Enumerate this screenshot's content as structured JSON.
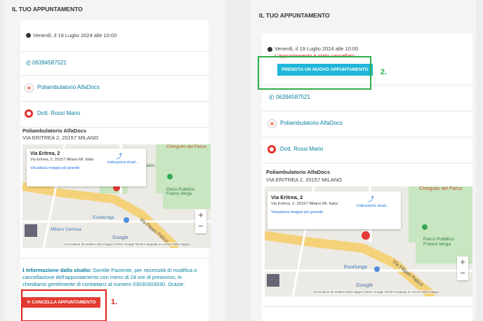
{
  "colors": {
    "annotation_red": "#e0231b",
    "annotation_green": "#2fad4a",
    "link": "#0a7fa0",
    "cancel": "#e23c32",
    "rebook": "#1fb6d8"
  },
  "left": {
    "title": "IL TUO APPUNTAMENTO",
    "date": "Venerdì, il 19 Luglio 2024 alle 10:00",
    "phone": "06394587521",
    "clinic": "Poliambulatorio AlfaDocs",
    "doctor": "Dott. Rossi Mario",
    "address_name": "Poliambulatorio AlfaDocs",
    "address_line": "VIA ERITREA 2, 20157 MILANO",
    "map": {
      "place": "Via Eritrea, 2",
      "place_addr": "Via Eritrea, 2, 20157 Milano MI, Italia",
      "directions": "Indicazioni strad...",
      "view_larger": "Visualizza mappa più grande",
      "footer": "Scorciatoie da tastiera   Dati mappa ©2024 Google   Termini   Segnala un errore nella mappa",
      "labels": [
        "Chinguito del Parco",
        "Calcio",
        "Parco Pubblico Franco Verga",
        "Via Filippo Palizzi",
        "Esselunga",
        "Milano Certosa",
        "Google"
      ]
    },
    "info_label": "Informazione dallo studio:",
    "info_text": "Gentile Paziente, per necessità di modifica o cancellazione dell'appuntamento con meno di 24 ore di preavviso, le chiediamo gentilmente di contattarci al numero 03030303030. Grazie.",
    "cancel_button": "CANCELLA APPUNTAMENTO",
    "annotation": "1."
  },
  "right": {
    "title": "IL TUO APPUNTAMENTO",
    "date": "Venerdì, il 19 Luglio 2024 alle 10:00",
    "cancelled": "L'appuntamento è stato cancellato",
    "rebook_button": "PRENOTA UN NUOVO APPUNTAMENTO",
    "annotation": "2.",
    "phone": "06394587521",
    "clinic": "Poliambulatorio AlfaDocs",
    "doctor": "Dott. Rossi Mario",
    "address_name": "Poliambulatorio AlfaDocs",
    "address_line": "VIA ERITREA 2, 20157 MILANO",
    "map": {
      "place": "Via Eritrea, 2",
      "place_addr": "Via Eritrea, 2, 20157 Milano MI, Italia",
      "directions": "Indicazioni strad...",
      "view_larger": "Visualizza mappa più grande",
      "footer": "Scorciatoie da tastiera   Dati mappa ©2024 Google   Termini   Segnala un errore nella mappa",
      "labels": [
        "Chinguito del Parco",
        "Parco Pubblico Franco Verga",
        "Via Filippo Palizzi",
        "Esselunga",
        "Google"
      ]
    }
  }
}
